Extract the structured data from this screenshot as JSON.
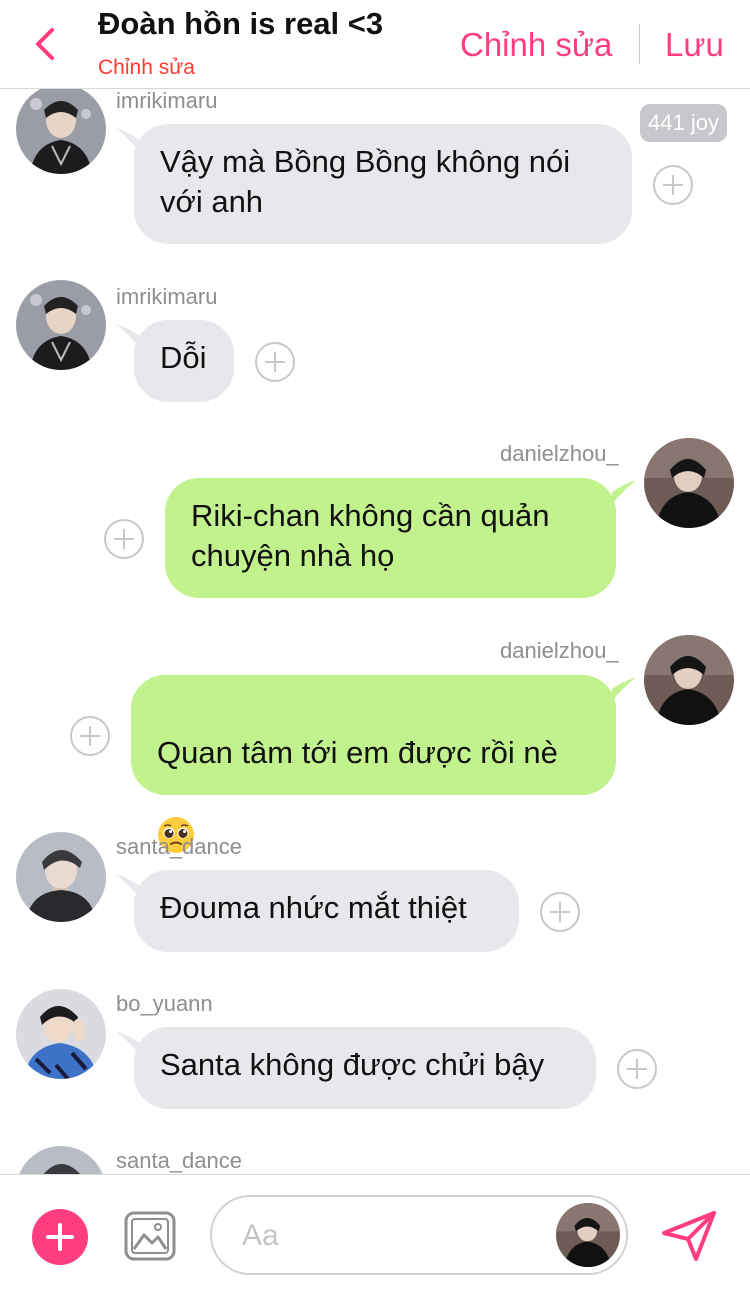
{
  "header": {
    "title": "Đoàn hồn is real <3",
    "subtitle": "Chỉnh sửa",
    "edit_label": "Chỉnh sửa",
    "save_label": "Lưu",
    "accent_color": "#ff3d7f",
    "subtitle_color": "#ff3b30"
  },
  "messages": [
    {
      "user": "imrikimaru",
      "text": "Vậy mà Bồng Bồng không nói\nvới anh",
      "side": "in",
      "badge": "441 joy"
    },
    {
      "user": "imrikimaru",
      "text": "Dỗi",
      "side": "in"
    },
    {
      "user": "danielzhou_",
      "text": "Riki-chan không cần quản\nchuyện nhà họ",
      "side": "out"
    },
    {
      "user": "danielzhou_",
      "text": "Quan tâm tới em được rồi nè",
      "emoji": "pleading-face",
      "side": "out"
    },
    {
      "user": "santa_dance",
      "text": "Đouma nhức mắt thiệt",
      "side": "in"
    },
    {
      "user": "bo_yuann",
      "text": "Santa không được chửi bậy",
      "side": "in"
    },
    {
      "user": "santa_dance",
      "side": "in"
    }
  ],
  "composer": {
    "placeholder": "Aa",
    "send_color": "#ff3d7f"
  },
  "colors": {
    "incoming_bubble": "#e6e8ec",
    "outgoing_bubble": "#c2f28e"
  }
}
